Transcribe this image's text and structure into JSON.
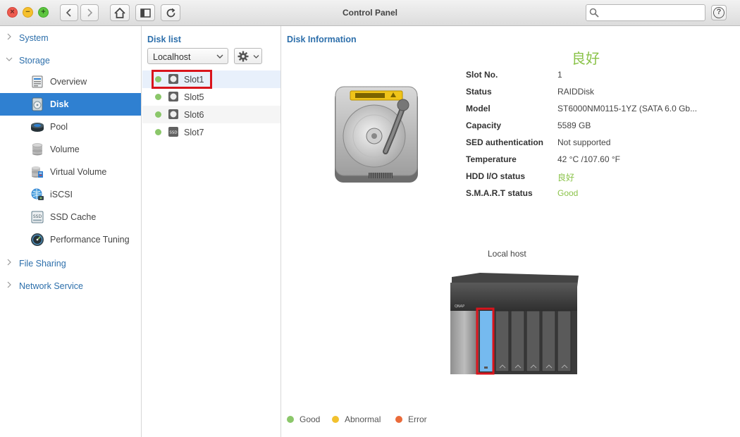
{
  "window": {
    "title": "Control Panel"
  },
  "search": {
    "placeholder": "",
    "value": ""
  },
  "help": {
    "label": "?"
  },
  "sidebar": {
    "categories": [
      {
        "label": "System",
        "expanded": false
      },
      {
        "label": "Storage",
        "expanded": true
      },
      {
        "label": "File Sharing",
        "expanded": false
      },
      {
        "label": "Network Service",
        "expanded": false
      }
    ],
    "storage_items": [
      {
        "label": "Overview",
        "icon": "overview-icon"
      },
      {
        "label": "Disk",
        "icon": "disk-icon",
        "active": true
      },
      {
        "label": "Pool",
        "icon": "pool-icon"
      },
      {
        "label": "Volume",
        "icon": "volume-icon"
      },
      {
        "label": "Virtual Volume",
        "icon": "virtual-volume-icon"
      },
      {
        "label": "iSCSI",
        "icon": "iscsi-icon"
      },
      {
        "label": "SSD Cache",
        "icon": "ssd-cache-icon"
      },
      {
        "label": "Performance Tuning",
        "icon": "performance-tuning-icon"
      }
    ]
  },
  "disk_list": {
    "title": "Disk list",
    "host_select": "Localhost",
    "slots": [
      {
        "label": "Slot1",
        "type": "hdd",
        "selected": true
      },
      {
        "label": "Slot5",
        "type": "hdd"
      },
      {
        "label": "Slot6",
        "type": "hdd"
      },
      {
        "label": "Slot7",
        "type": "ssd",
        "badge": "SSD"
      }
    ]
  },
  "disk_info": {
    "title": "Disk Information",
    "status_headline": "良好",
    "rows": [
      {
        "label": "Slot No.",
        "value": "1"
      },
      {
        "label": "Status",
        "value": "RAIDDisk"
      },
      {
        "label": "Model",
        "value": "ST6000NM0115-1YZ (SATA 6.0 Gb..."
      },
      {
        "label": "Capacity",
        "value": "5589 GB"
      },
      {
        "label": "SED authentication",
        "value": "Not supported"
      },
      {
        "label": "Temperature",
        "value": "42 °C /107.60 °F"
      },
      {
        "label": "HDD I/O status",
        "value": "良好",
        "good": true
      },
      {
        "label": "S.M.A.R.T status",
        "value": "Good",
        "good": true
      }
    ],
    "nas_label": "Local host",
    "nas_brand": "QNAP",
    "legend": [
      {
        "label": "Good",
        "color": "#8bc76a"
      },
      {
        "label": "Abnormal",
        "color": "#f2c12e"
      },
      {
        "label": "Error",
        "color": "#ea6b3a"
      }
    ]
  },
  "colors": {
    "accent": "#2f80d1",
    "good": "#8bc34a",
    "link": "#2d6fab",
    "highlight": "#d9141c"
  }
}
